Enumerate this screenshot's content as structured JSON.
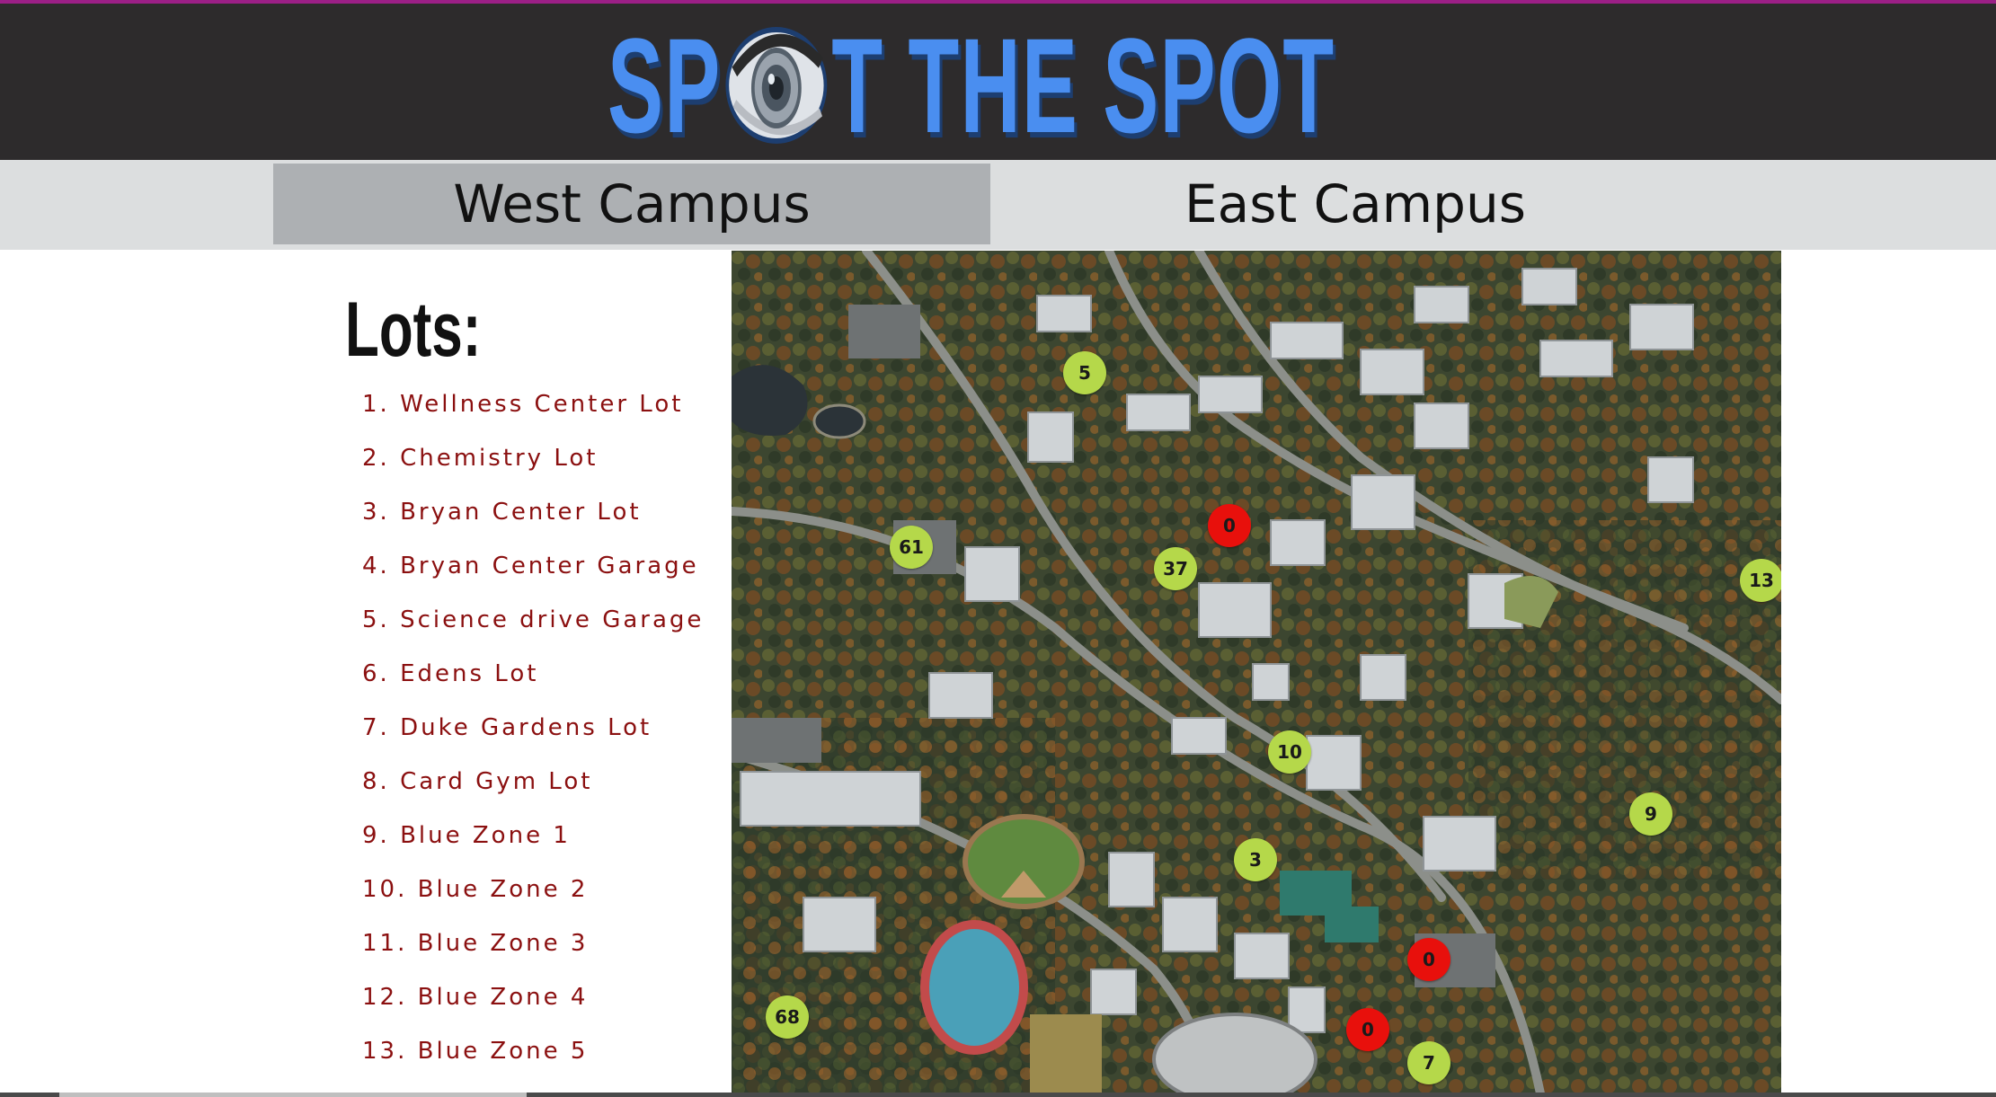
{
  "header": {
    "logo_text_before": "SP",
    "logo_text_after": "T THE SPOT",
    "logo_icon": "eye-camera-icon",
    "accent_color": "#4a8ef0",
    "background_color": "#2d2b2c"
  },
  "tabs": [
    {
      "label": "West Campus",
      "active": true
    },
    {
      "label": "East Campus",
      "active": false
    }
  ],
  "lots": {
    "title": "Lots:",
    "items": [
      "1. Wellness Center Lot",
      "2. Chemistry Lot",
      "3. Bryan Center Lot",
      "4. Bryan Center Garage",
      "5. Science drive Garage",
      "6. Edens Lot",
      "7. Duke Gardens Lot",
      "8. Card Gym Lot",
      "9. Blue Zone 1",
      "10. Blue Zone 2",
      "11. Blue Zone 3",
      "12. Blue Zone 4",
      "13. Blue Zone 5"
    ]
  },
  "map": {
    "type": "satellite-campus-map",
    "available_color": "#b5d84a",
    "full_color": "#e8100c",
    "markers": [
      "5",
      "0",
      "61",
      "37",
      "13",
      "10",
      "9",
      "3",
      "0",
      "68",
      "0",
      "7"
    ]
  }
}
